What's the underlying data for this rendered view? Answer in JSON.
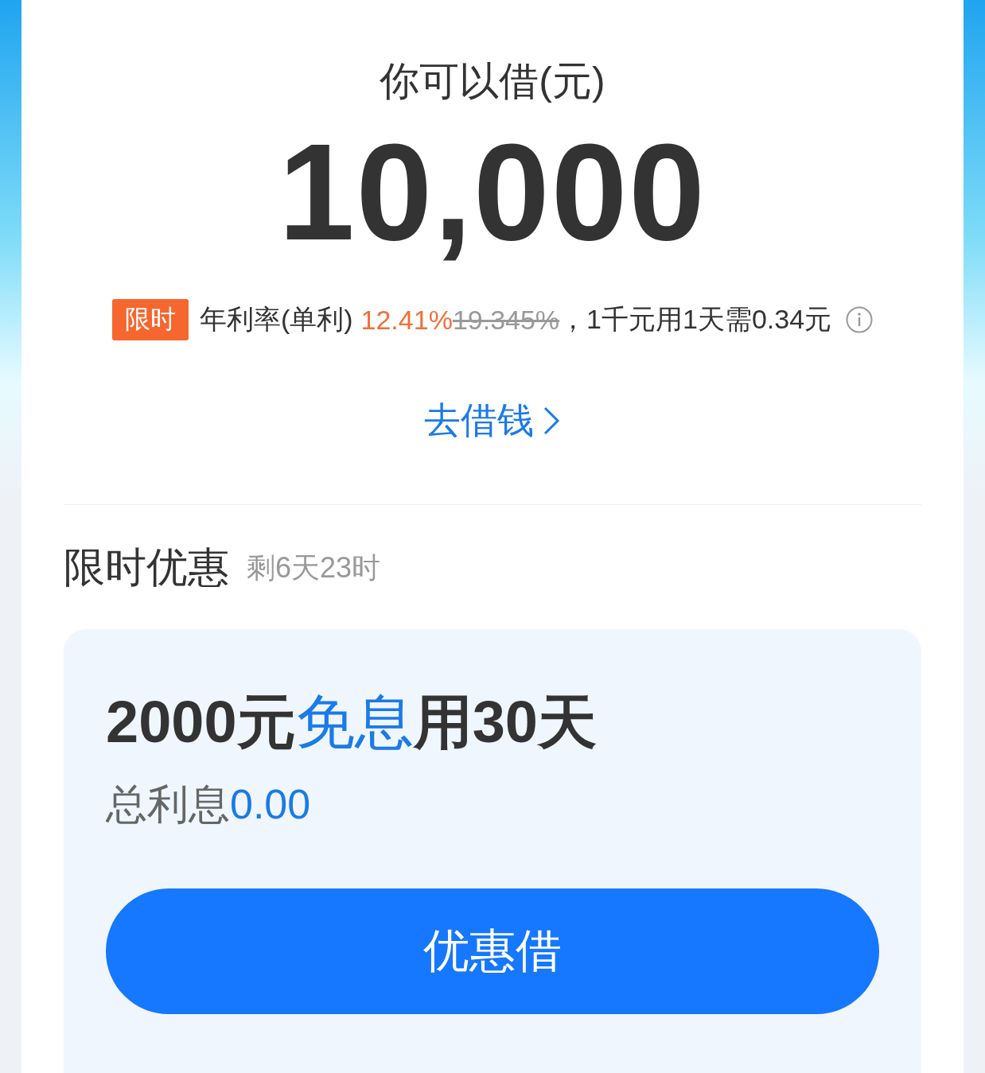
{
  "loan": {
    "label": "你可以借(元)",
    "amount": "10,000"
  },
  "rate": {
    "badge": "限时",
    "label": "年利率(单利)",
    "current_rate": "12.41%",
    "original_rate": "19.345%",
    "note": "，1千元用1天需0.34元"
  },
  "borrow_link": "去借钱",
  "promo": {
    "title": "限时优惠",
    "remaining": "剩6天23时",
    "offer": [
      {
        "text": "2000元",
        "highlight": false
      },
      {
        "text": "免息",
        "highlight": true
      },
      {
        "text": "用30天",
        "highlight": false
      }
    ],
    "interest": [
      {
        "text": "总利息",
        "highlight": false
      },
      {
        "text": "0.00",
        "highlight": true
      }
    ],
    "button": "优惠借"
  }
}
